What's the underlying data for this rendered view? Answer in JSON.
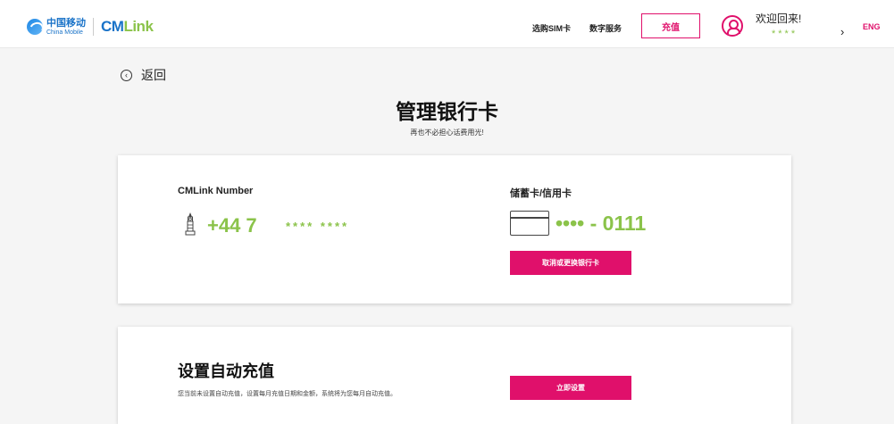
{
  "header": {
    "logo_cn": "中国移动",
    "logo_en": "China Mobile",
    "brand_cm": "CM",
    "brand_link": "Link",
    "nav": {
      "sim": "选购SIM卡",
      "digital": "数字服务"
    },
    "recharge_label": "充值",
    "welcome": "欢迎回来!",
    "user_masked": "****",
    "chevron": "›",
    "lang": "ENG"
  },
  "back_label": "返回",
  "back_icon": "‹",
  "page": {
    "title": "管理银行卡",
    "subtitle": "再也不必担心话费用光!"
  },
  "number_section": {
    "label": "CMLink Number",
    "prefix": "+44 7",
    "masked": "**** ****"
  },
  "card_section": {
    "label": "储蓄卡/信用卡",
    "number": "•••• - 0111",
    "button": "取消或更换银行卡"
  },
  "auto_topup": {
    "title": "设置自动充值",
    "description": "您当前未设置自动充值，设置每月充值日期和金额，系统将为您每月自动充值。",
    "button": "立即设置"
  },
  "colors": {
    "accent": "#e0106b",
    "green": "#8bc34a",
    "brand_blue": "#1a73c8"
  }
}
